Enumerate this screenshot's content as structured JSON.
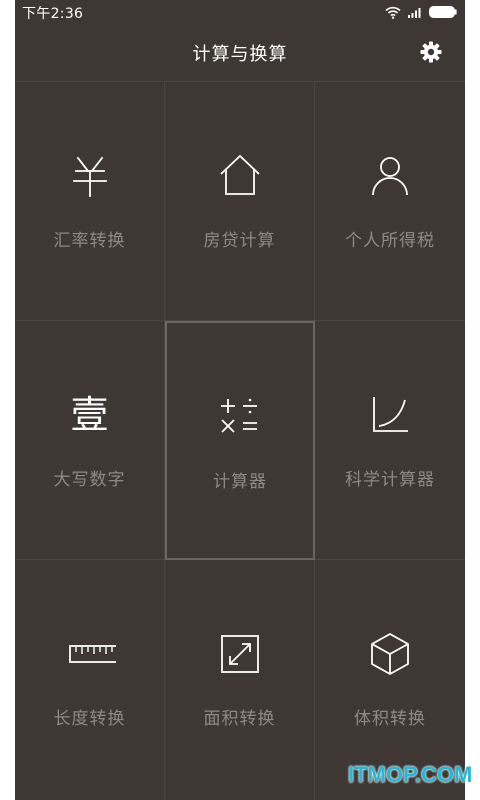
{
  "status_bar": {
    "time": "下午2:36",
    "icons": [
      "wifi-icon",
      "signal-icon",
      "battery-icon"
    ]
  },
  "header": {
    "title": "计算与换算",
    "settings_icon": "gear-icon"
  },
  "tiles": [
    {
      "label": "汇率转换",
      "icon": "yuan-icon"
    },
    {
      "label": "房贷计算",
      "icon": "house-icon"
    },
    {
      "label": "个人所得税",
      "icon": "person-icon"
    },
    {
      "label": "大写数字",
      "icon": "capital-numeral-icon",
      "glyph": "壹"
    },
    {
      "label": "计算器",
      "icon": "calculator-operators-icon",
      "selected": true
    },
    {
      "label": "科学计算器",
      "icon": "curve-graph-icon"
    },
    {
      "label": "长度转换",
      "icon": "ruler-icon"
    },
    {
      "label": "面积转换",
      "icon": "expand-arrows-icon"
    },
    {
      "label": "体积转换",
      "icon": "cube-icon"
    }
  ],
  "watermark": "ITMOP.COM",
  "colors": {
    "background": "#3e3734",
    "label": "#8f8884",
    "icon": "#ffffff",
    "grid_line": "#4c4542",
    "watermark": "#23b8d8"
  }
}
